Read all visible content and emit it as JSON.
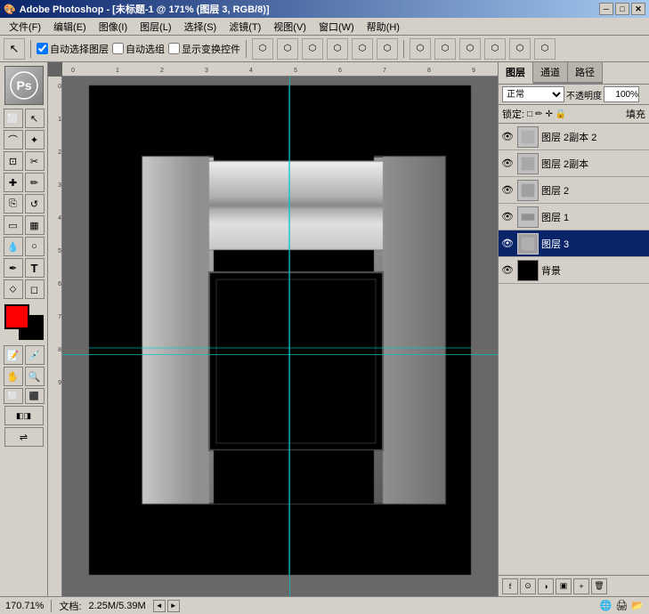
{
  "titlebar": {
    "title": "Adobe Photoshop - [未标题-1 @ 171% (图层 3, RGB/8)]",
    "app": "Adobe Photoshop",
    "doc": "未标题-1 @ 171% (图层 3, RGB/8)",
    "min_btn": "─",
    "max_btn": "□",
    "close_btn": "✕"
  },
  "menubar": {
    "items": [
      "文件(F)",
      "编辑(E)",
      "图像(I)",
      "图层(L)",
      "选择(S)",
      "滤镜(T)",
      "视图(V)",
      "窗口(W)",
      "帮助(H)"
    ]
  },
  "toolbar": {
    "auto_select_layer": "自动选择图层",
    "auto_select_group": "自动选组",
    "show_transform": "显示变换控件"
  },
  "layers_panel": {
    "tabs": [
      "图层",
      "通道",
      "路径"
    ],
    "active_tab": "图层",
    "blend_mode": "正常",
    "opacity_label": "不透明度",
    "opacity_value": "100%",
    "lock_label": "锁定:",
    "fill_label": "填充",
    "layers": [
      {
        "name": "图层 2副本 2",
        "visible": true,
        "selected": false,
        "thumb_color": "#c0c0c0"
      },
      {
        "name": "图层 2副本",
        "visible": true,
        "selected": false,
        "thumb_color": "#c0c0c0"
      },
      {
        "name": "图层 2",
        "visible": true,
        "selected": false,
        "thumb_color": "#c0c0c0"
      },
      {
        "name": "图层 1",
        "visible": true,
        "selected": false,
        "thumb_color": "#c0c0c0"
      },
      {
        "name": "图层 3",
        "visible": true,
        "selected": true,
        "thumb_color": "#a0a0a0"
      },
      {
        "name": "背景",
        "visible": true,
        "selected": false,
        "thumb_color": "#000000"
      }
    ]
  },
  "statusbar": {
    "zoom": "170.71%",
    "doc_label": "文档:",
    "doc_size": "2.25M/5.39M",
    "nav_prev": "◄",
    "nav_next": "►"
  },
  "colors": {
    "fg": "#ff0000",
    "bg": "#000000",
    "accent_blue": "#0a246a",
    "guide_cyan": "rgba(0,200,200,0.7)"
  }
}
